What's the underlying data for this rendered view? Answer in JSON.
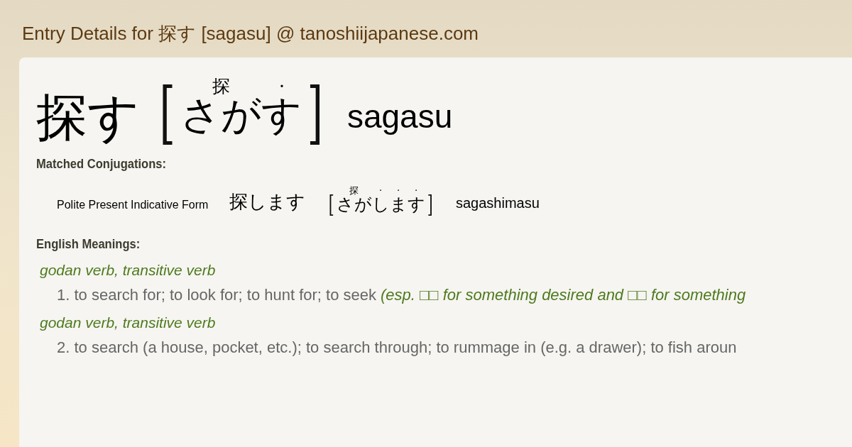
{
  "page_title": "Entry Details for 探す [sagasu] @ tanoshiijapanese.com",
  "entry": {
    "word": "探す",
    "open": "[",
    "close": "]",
    "reading": [
      {
        "base": "さが",
        "above": "探"
      },
      {
        "base": "す",
        "above": "·"
      }
    ],
    "romaji": "sagasu"
  },
  "conjugations": {
    "heading": "Matched Conjugations:",
    "rows": [
      {
        "form": "Polite Present Indicative Form",
        "word": "探します",
        "open": "[",
        "close": "]",
        "reading": [
          {
            "base": "さが",
            "above": "探"
          },
          {
            "base": "し",
            "above": "·"
          },
          {
            "base": "ま",
            "above": "·"
          },
          {
            "base": "す",
            "above": "·"
          }
        ],
        "romaji": "sagashimasu"
      }
    ]
  },
  "meanings": {
    "heading": "English Meanings:",
    "senses": [
      {
        "pos": "godan verb, transitive verb",
        "text": "1. to search for; to look for; to hunt for; to seek",
        "note": "(esp. □□ for something desired and □□ for something"
      },
      {
        "pos": "godan verb, transitive verb",
        "text": "2. to search (a house, pocket, etc.); to search through; to rummage in (e.g. a drawer); to fish aroun"
      }
    ]
  }
}
